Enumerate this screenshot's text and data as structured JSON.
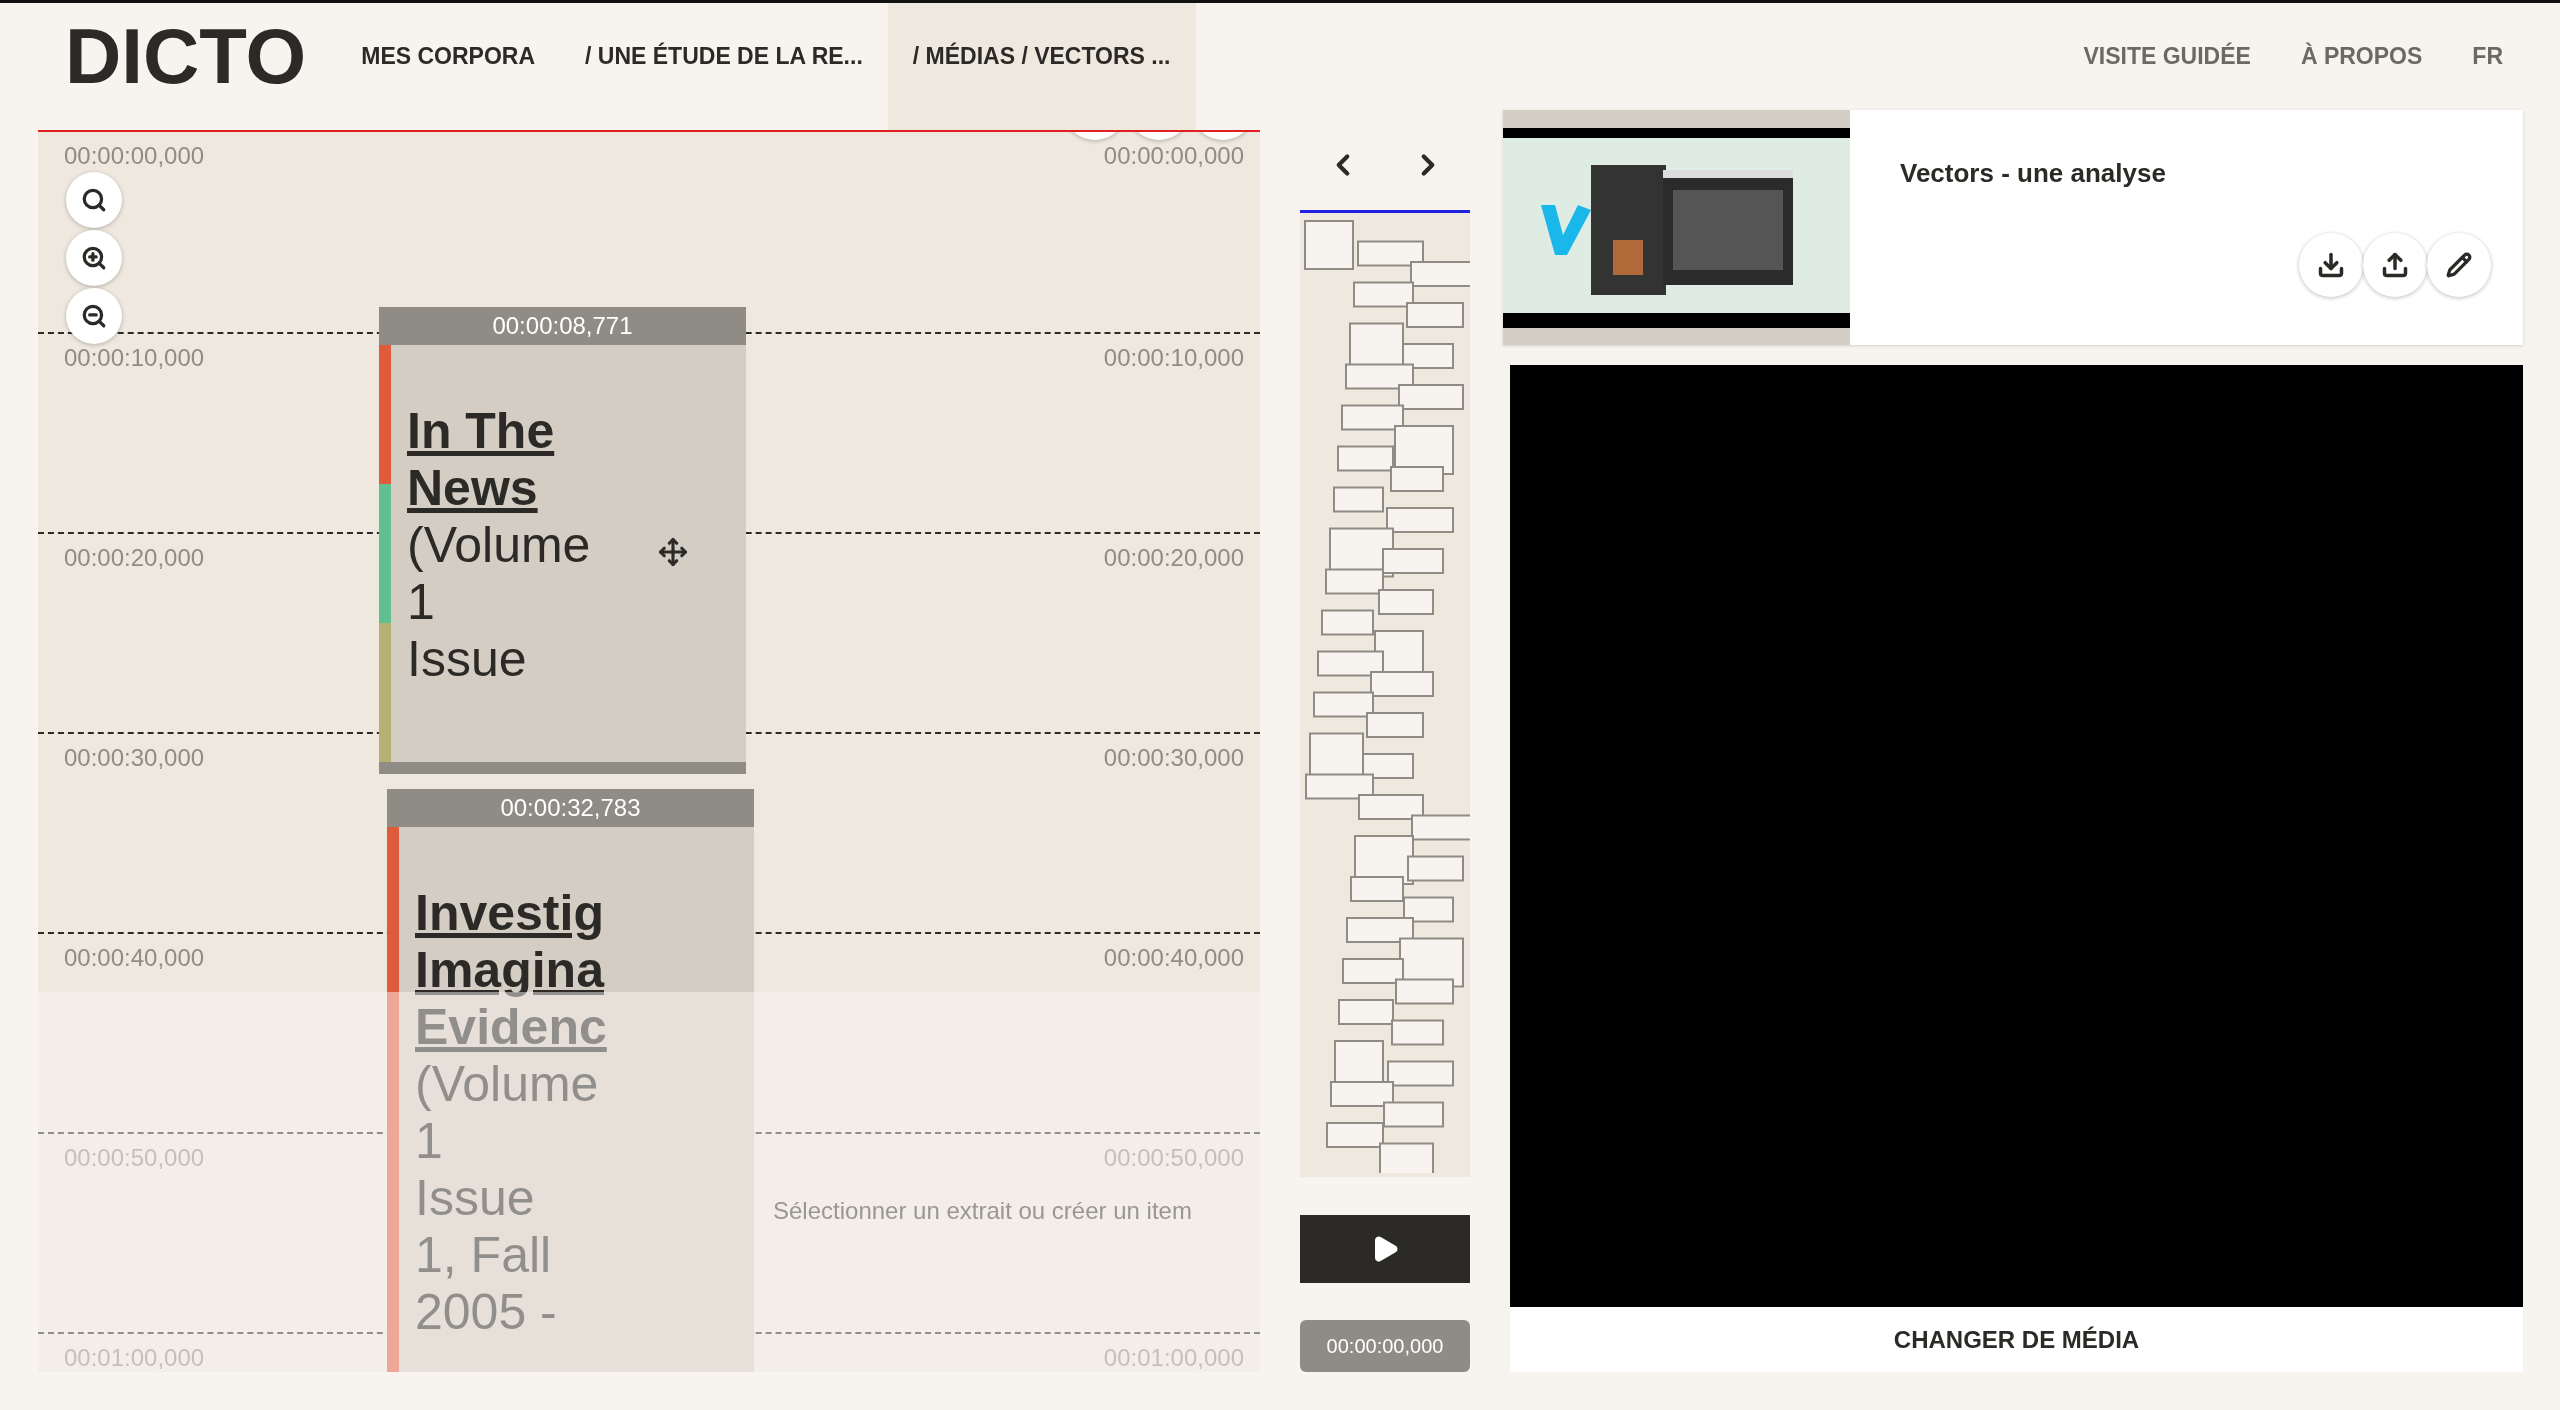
{
  "header": {
    "logo": "DICTO",
    "breadcrumbs": [
      {
        "label": "MES CORPORA",
        "selected": false
      },
      {
        "label": "/ UNE ÉTUDE DE LA RE...",
        "selected": false
      },
      {
        "label": "/ MÉDIAS / VECTORS ...",
        "selected": true
      }
    ],
    "links": [
      "VISITE GUIDÉE",
      "À PROPOS",
      "FR"
    ]
  },
  "timeline": {
    "ticks": [
      {
        "left": "00:00:00,000",
        "right": "00:00:00,000"
      },
      {
        "left": "00:00:10,000",
        "right": "00:00:10,000"
      },
      {
        "left": "00:00:20,000",
        "right": "00:00:20,000"
      },
      {
        "left": "00:00:30,000",
        "right": "00:00:30,000"
      },
      {
        "left": "00:00:40,000",
        "right": "00:00:40,000"
      },
      {
        "left": "00:00:50,000",
        "right": "00:00:50,000"
      },
      {
        "left": "00:01:00,000",
        "right": "00:01:00,000"
      }
    ],
    "items": [
      {
        "start": "00:00:08,771",
        "title_lines": [
          "In The",
          "News"
        ],
        "text_lines": [
          "(Volume",
          "1",
          "Issue"
        ],
        "stripes": [
          {
            "color": "#e05a3c"
          },
          {
            "color": "#5fbf8f"
          },
          {
            "color": "#b5b173"
          }
        ]
      },
      {
        "start": "00:00:32,783",
        "title_lines": [
          "Investig",
          "Imagina",
          "Evidenc"
        ],
        "text_lines": [
          "(Volume",
          "1",
          "Issue",
          "1, Fall",
          "2005 -"
        ],
        "stripes": [
          {
            "color": "#e05a3c"
          }
        ]
      }
    ],
    "hint": "Sélectionner un extrait ou créer un item"
  },
  "player": {
    "time": "00:00:00,000"
  },
  "media": {
    "title": "Vectors - une analyse",
    "action": "CHANGER DE MÉDIA"
  }
}
